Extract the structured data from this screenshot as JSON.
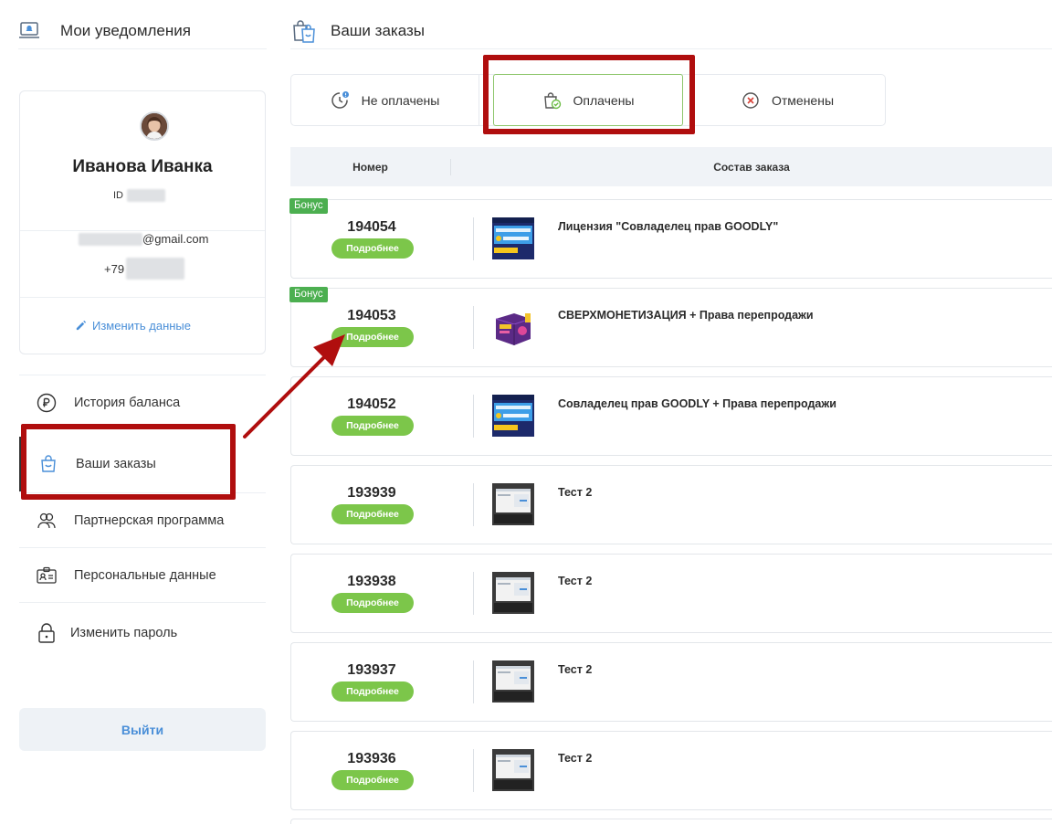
{
  "sidebar": {
    "notifications_title": "Мои уведомления",
    "profile": {
      "name": "Иванова Иванка",
      "id_label": "ID",
      "email_suffix": "@gmail.com",
      "phone_prefix": "+79",
      "edit_label": "Изменить данные"
    },
    "menu": [
      {
        "label": "История баланса",
        "icon": "ruble-icon"
      },
      {
        "label": "Ваши заказы",
        "icon": "shopping-bag-icon"
      },
      {
        "label": "Партнерская программа",
        "icon": "people-icon"
      },
      {
        "label": "Персональные данные",
        "icon": "id-card-icon"
      },
      {
        "label": "Изменить пароль",
        "icon": "lock-icon"
      }
    ],
    "logout_label": "Выйти"
  },
  "main": {
    "title": "Ваши заказы",
    "tabs": [
      {
        "label": "Не оплачены",
        "icon": "clock-alert-icon"
      },
      {
        "label": "Оплачены",
        "icon": "bag-check-icon",
        "active": true
      },
      {
        "label": "Отменены",
        "icon": "cancel-circle-icon"
      }
    ],
    "table": {
      "col_number": "Номер",
      "col_contents": "Состав заказа"
    },
    "details_label": "Подробнее",
    "bonus_label": "Бонус",
    "orders": [
      {
        "number": "194054",
        "title": "Лицензия \"Совладелец прав GOODLY\"",
        "bonus": true,
        "thumb": "goodly"
      },
      {
        "number": "194053",
        "title": "СВЕРХМОНЕТИЗАЦИЯ + Права перепродажи",
        "bonus": true,
        "thumb": "box"
      },
      {
        "number": "194052",
        "title": "Совладелец прав GOODLY + Права перепродажи",
        "bonus": false,
        "thumb": "goodly"
      },
      {
        "number": "193939",
        "title": "Тест 2",
        "bonus": false,
        "thumb": "laptop"
      },
      {
        "number": "193938",
        "title": "Тест 2",
        "bonus": false,
        "thumb": "laptop"
      },
      {
        "number": "193937",
        "title": "Тест 2",
        "bonus": false,
        "thumb": "laptop"
      },
      {
        "number": "193936",
        "title": "Тест 2",
        "bonus": false,
        "thumb": "laptop"
      }
    ]
  },
  "colors": {
    "accent_blue": "#4a8fd8",
    "green_button": "#7cc64a",
    "bonus_green": "#4caf50",
    "annotation_red": "#b00e0e"
  }
}
